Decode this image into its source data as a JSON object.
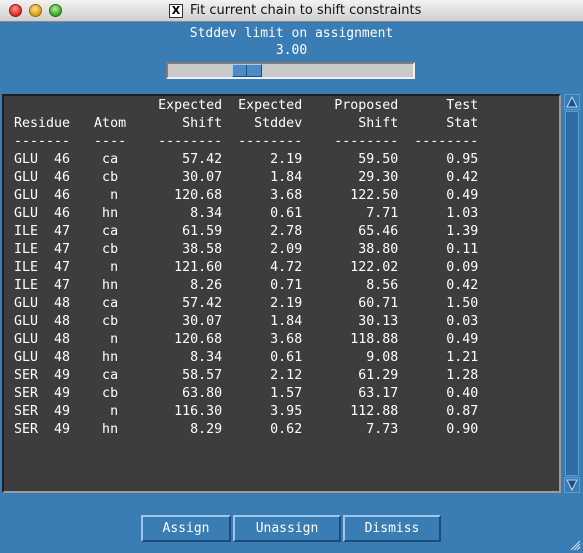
{
  "window": {
    "title": "Fit current chain to shift constraints",
    "title_icon": "x-window-icon"
  },
  "slider": {
    "label": "Stddev limit on assignment",
    "value": "3.00"
  },
  "table": {
    "header_line1": "                  Expected  Expected    Proposed      Test",
    "header_line2": "Residue   Atom       Shift    Stddev       Shift      Stat",
    "rule": "-------   ----    --------  --------    --------  --------",
    "rows": [
      "GLU  46    ca        57.42      2.19       59.50      0.95",
      "GLU  46    cb        30.07      1.84       29.30      0.42",
      "GLU  46     n       120.68      3.68      122.50      0.49",
      "GLU  46    hn         8.34      0.61        7.71      1.03",
      "ILE  47    ca        61.59      2.78       65.46      1.39",
      "ILE  47    cb        38.58      2.09       38.80      0.11",
      "ILE  47     n       121.60      4.72      122.02      0.09",
      "ILE  47    hn         8.26      0.71        8.56      0.42",
      "GLU  48    ca        57.42      2.19       60.71      1.50",
      "GLU  48    cb        30.07      1.84       30.13      0.03",
      "GLU  48     n       120.68      3.68      118.88      0.49",
      "GLU  48    hn         8.34      0.61        9.08      1.21",
      "SER  49    ca        58.57      2.12       61.29      1.28",
      "SER  49    cb        63.80      1.57       63.17      0.40",
      "SER  49     n       116.30      3.95      112.88      0.87",
      "SER  49    hn         8.29      0.62        7.73      0.90"
    ]
  },
  "buttons": {
    "assign": "Assign",
    "unassign": "Unassign",
    "dismiss": "Dismiss"
  }
}
